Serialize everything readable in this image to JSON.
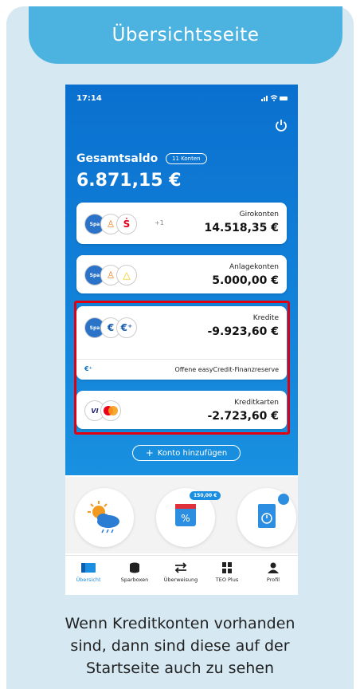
{
  "header": {
    "title": "Übersichtsseite"
  },
  "phone": {
    "status": {
      "time": "17:14",
      "icons": "..ıl ≈ ▬"
    },
    "saldo": {
      "label": "Gesamtsaldo",
      "badge": "11 Konten",
      "value": "6.871,15 €"
    },
    "accounts": [
      {
        "name": "Girokonten",
        "amount": "14.518,35 €",
        "more": "+1"
      },
      {
        "name": "Anlagekonten",
        "amount": "5.000,00 €"
      },
      {
        "name": "Kredite",
        "amount": "-9.923,60 €"
      },
      {
        "name": "Kreditkarten",
        "amount": "-2.723,60 €"
      }
    ],
    "easycredit": "Offene easyCredit-Finanzreserve",
    "add_account": "Konto hinzufügen",
    "widget_badge": "150,00 €",
    "tabs": [
      {
        "label": "Übersicht",
        "icon": "overview-icon"
      },
      {
        "label": "Sparboxen",
        "icon": "coins-icon"
      },
      {
        "label": "Überweisung",
        "icon": "transfer-icon"
      },
      {
        "label": "TEO Plus",
        "icon": "grid-icon"
      },
      {
        "label": "Profil",
        "icon": "person-icon"
      }
    ]
  },
  "caption": {
    "line1": "Wenn Kreditkonten vorhanden",
    "line2": "sind, dann sind diese auf der",
    "line3": "Startseite auch zu sehen"
  },
  "colors": {
    "accent": "#4cb2e0",
    "phone_blue": "#0a70cf",
    "highlight": "#e00010",
    "bg": "#d6e8f2"
  }
}
